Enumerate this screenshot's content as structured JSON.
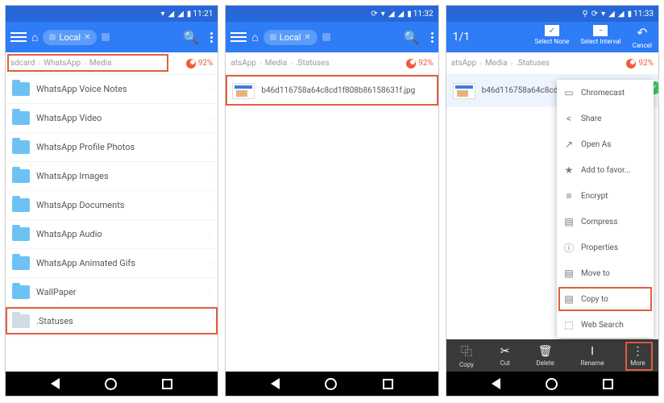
{
  "screens": [
    {
      "time": "11:21",
      "appbar_type": "browse",
      "chip_label": "Local",
      "breadcrumb": [
        "sdcard",
        "WhatsApp",
        "Media"
      ],
      "storage_pct": "92%",
      "highlight_breadcrumb": true,
      "rows": [
        {
          "type": "folder",
          "label": "WhatsApp Voice Notes"
        },
        {
          "type": "folder",
          "label": "WhatsApp Video"
        },
        {
          "type": "folder",
          "label": "WhatsApp Profile Photos"
        },
        {
          "type": "folder",
          "label": "WhatsApp Images"
        },
        {
          "type": "folder",
          "label": "WhatsApp Documents"
        },
        {
          "type": "folder",
          "label": "WhatsApp Audio"
        },
        {
          "type": "folder",
          "label": "WhatsApp Animated Gifs"
        },
        {
          "type": "folder",
          "label": "WallPaper"
        },
        {
          "type": "folder-dim",
          "label": ".Statuses",
          "highlight": true
        }
      ]
    },
    {
      "time": "11:32",
      "appbar_type": "browse",
      "chip_label": "Local",
      "breadcrumb": [
        "atsApp",
        "Media",
        ".Statuses"
      ],
      "storage_pct": "92%",
      "highlight_row0": true,
      "rows": [
        {
          "type": "thumb",
          "label": "b46d116758a64c8cd1f808b86158631f.jpg"
        }
      ]
    },
    {
      "time": "11:33",
      "appbar_type": "select",
      "count": "1/1",
      "sel_actions": [
        {
          "label": "Select None",
          "icon": "check"
        },
        {
          "label": "Select Interval",
          "icon": "minus"
        },
        {
          "label": "Cancel",
          "icon": "undo"
        }
      ],
      "breadcrumb": [
        "atsApp",
        "Media",
        ".Statuses"
      ],
      "storage_pct": "92%",
      "rows": [
        {
          "type": "thumb",
          "label": "b46d116758a64c8cd1f808b",
          "selected": true,
          "check": true
        }
      ],
      "menu": [
        {
          "icon": "⬚",
          "label": "Chromecast"
        },
        {
          "icon": "<",
          "label": "Share"
        },
        {
          "icon": "↗",
          "label": "Open As"
        },
        {
          "icon": "★",
          "label": "Add to favor..."
        },
        {
          "icon": "≡",
          "label": "Encrypt"
        },
        {
          "icon": "▤",
          "label": "Compress"
        },
        {
          "icon": "ⓘ",
          "label": "Properties"
        },
        {
          "icon": "▤",
          "label": "Move to"
        },
        {
          "icon": "▤",
          "label": "Copy to",
          "highlight": true
        },
        {
          "icon": "⬚",
          "label": "Web Search"
        }
      ],
      "action_bar": [
        {
          "icon": "⿻",
          "label": "Copy"
        },
        {
          "icon": "✂",
          "label": "Cut"
        },
        {
          "icon": "🗑",
          "label": "Delete"
        },
        {
          "icon": "I",
          "label": "Rename"
        },
        {
          "icon": "⋮",
          "label": "More",
          "highlight": true
        }
      ]
    }
  ]
}
